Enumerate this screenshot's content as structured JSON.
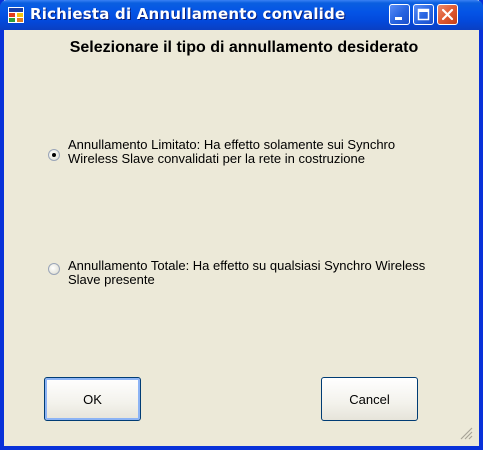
{
  "window": {
    "title": "Richiesta di Annullamento convalide"
  },
  "dialog": {
    "heading": "Selezionare il tipo di annullamento desiderato",
    "options": [
      {
        "label": "Annullamento Limitato: Ha effetto solamente sui Synchro Wireless Slave convalidati per la rete in costruzione",
        "selected": true
      },
      {
        "label": "Annullamento Totale: Ha effetto su qualsiasi Synchro Wireless Slave presente",
        "selected": false
      }
    ],
    "ok_label": "OK",
    "cancel_label": "Cancel"
  },
  "colors": {
    "titlebar": "#0454E6",
    "window_bg": "#ECE9D8",
    "close_button": "#E05A32"
  }
}
